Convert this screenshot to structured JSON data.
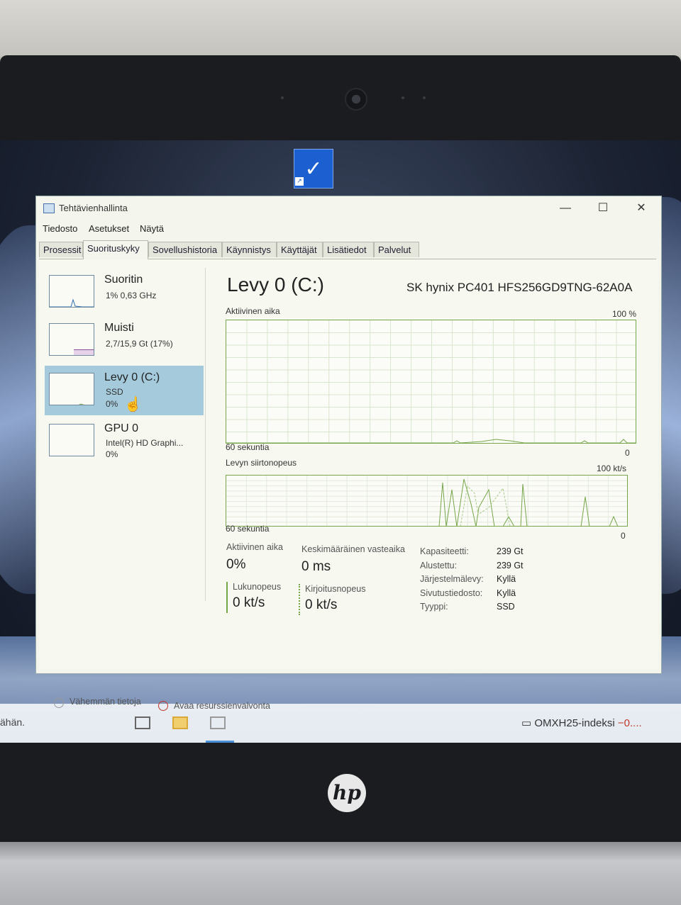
{
  "window": {
    "title": "Tehtävienhallinta",
    "controls": {
      "minimize": "—",
      "maximize": "☐",
      "close": "✕"
    }
  },
  "menu": [
    "Tiedosto",
    "Asetukset",
    "Näytä"
  ],
  "tabs": [
    "Prosessit",
    "Suorituskyky",
    "Sovellushistoria",
    "Käynnistys",
    "Käyttäjät",
    "Lisätiedot",
    "Palvelut"
  ],
  "active_tab": "Suorituskyky",
  "sidebar": [
    {
      "name": "Suoritin",
      "line1": "1% 0,63 GHz",
      "line2": ""
    },
    {
      "name": "Muisti",
      "line1": "2,7/15,9 Gt (17%)",
      "line2": ""
    },
    {
      "name": "Levy 0 (C:)",
      "line1": "SSD",
      "line2": "0%"
    },
    {
      "name": "GPU 0",
      "line1": "Intel(R) HD Graphi...",
      "line2": "0%"
    }
  ],
  "main": {
    "title": "Levy 0 (C:)",
    "model": "SK hynix PC401 HFS256GD9TNG-62A0A",
    "graph1": {
      "label": "Aktiivinen aika",
      "max": "100 %",
      "time": "60 sekuntia",
      "min": "0"
    },
    "graph2": {
      "label": "Levyn siirtonopeus",
      "max": "100 kt/s",
      "time": "60 sekuntia",
      "min": "0"
    },
    "stats": {
      "active_label": "Aktiivinen aika",
      "active_value": "0%",
      "response_label": "Keskimääräinen vasteaika",
      "response_value": "0 ms",
      "read_label": "Lukunopeus",
      "read_value": "0 kt/s",
      "write_label": "Kirjoitusnopeus",
      "write_value": "0 kt/s"
    },
    "properties": [
      {
        "key": "Kapasiteetti:",
        "value": "239 Gt"
      },
      {
        "key": "Alustettu:",
        "value": "239 Gt"
      },
      {
        "key": "Järjestelmälevy:",
        "value": "Kyllä"
      },
      {
        "key": "Sivutustiedosto:",
        "value": "Kyllä"
      },
      {
        "key": "Tyyppi:",
        "value": "SSD"
      }
    ]
  },
  "footer": {
    "less_details": "Vähemmän tietoja",
    "open_monitor": "Avaa resurssienvalvonta"
  },
  "taskbar": {
    "search_text": "ähän.",
    "stock_name": "OMXH25-indeksi",
    "stock_change": "−0...."
  },
  "colors": {
    "graph_line": "#76a64a",
    "selected": "#a4cadc",
    "window_bg": "#f4f5ec"
  },
  "brand": "hp"
}
